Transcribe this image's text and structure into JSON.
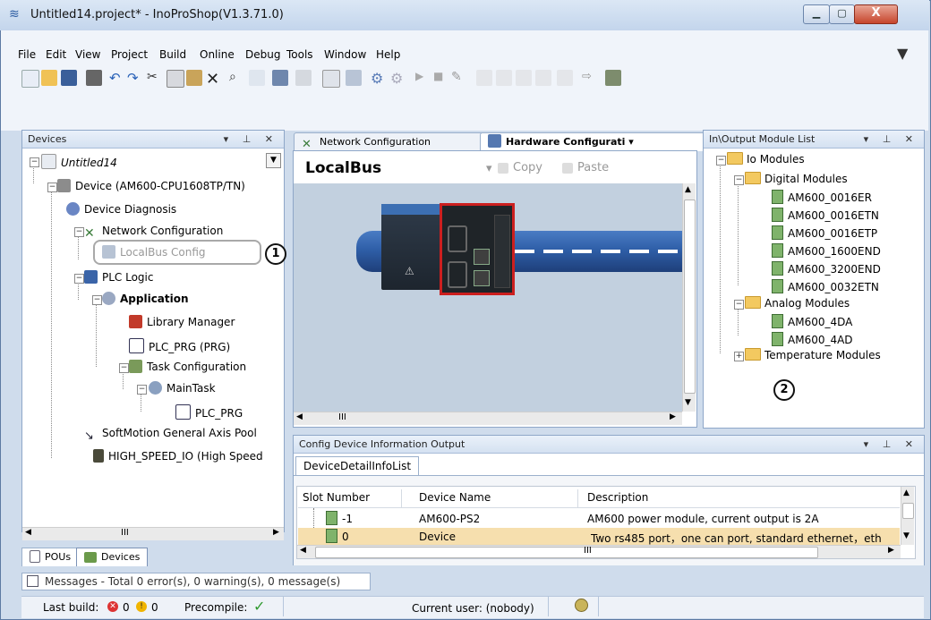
{
  "window": {
    "title": "Untitled14.project* - InoProShop(V1.3.71.0)",
    "close_label": "X"
  },
  "menu": [
    "File",
    "Edit",
    "View",
    "Project",
    "Build",
    "Online",
    "Debug",
    "Tools",
    "Window",
    "Help"
  ],
  "devices_panel": {
    "title": "Devices",
    "tree": {
      "root": "Untitled14",
      "device": "Device (AM600-CPU1608TP/TN)",
      "diagnosis": "Device Diagnosis",
      "network": "Network Configuration",
      "localbus": "LocalBus Config",
      "plc_logic": "PLC Logic",
      "application": "Application",
      "library": "Library Manager",
      "plc_prg": "PLC_PRG (PRG)",
      "task_config": "Task Configuration",
      "main_task": "MainTask",
      "plc_prg_task": "PLC_PRG",
      "softmotion": "SoftMotion General Axis Pool",
      "high_speed": "HIGH_SPEED_IO (High Speed"
    },
    "scroll_label": "III",
    "bottom_tabs": [
      "POUs",
      "Devices"
    ]
  },
  "editor": {
    "tabs": [
      "Network Configuration",
      "Hardware Configurati"
    ],
    "localbus_label": "LocalBus",
    "copy_label": "Copy",
    "paste_label": "Paste",
    "scroll_label": "III"
  },
  "io_panel": {
    "title": "In\\Output Module List",
    "root": "Io Modules",
    "groups": [
      {
        "name": "Digital Modules",
        "items": [
          "AM600_0016ER",
          "AM600_0016ETN",
          "AM600_0016ETP",
          "AM600_1600END",
          "AM600_3200END",
          "AM600_0032ETN"
        ]
      },
      {
        "name": "Analog Modules",
        "items": [
          "AM600_4DA",
          "AM600_4AD"
        ]
      },
      {
        "name": "Temperature Modules",
        "items": []
      }
    ]
  },
  "info_panel": {
    "title": "Config Device Information Output",
    "tab": "DeviceDetailInfoList",
    "columns": [
      "Slot Number",
      "Device Name",
      "Description"
    ],
    "rows": [
      {
        "slot": "-1",
        "name": "AM600-PS2",
        "desc": "AM600 power module, current output is 2A"
      },
      {
        "slot": "0",
        "name": "Device",
        "desc": "Two rs485 port，one can port, standard ethernet，eth"
      }
    ],
    "scroll_label": "III"
  },
  "messages": "Messages - Total 0 error(s), 0 warning(s), 0 message(s)",
  "status": {
    "last_build": "Last build:",
    "errors": "0",
    "warnings": "0",
    "precompile": "Precompile:",
    "current_user": "Current user: (nobody)"
  },
  "callouts": [
    "1",
    "2"
  ],
  "colors": {
    "accent": "#cc1f1f",
    "selection": "#f6dfae",
    "rail": "#2f5fa8"
  }
}
